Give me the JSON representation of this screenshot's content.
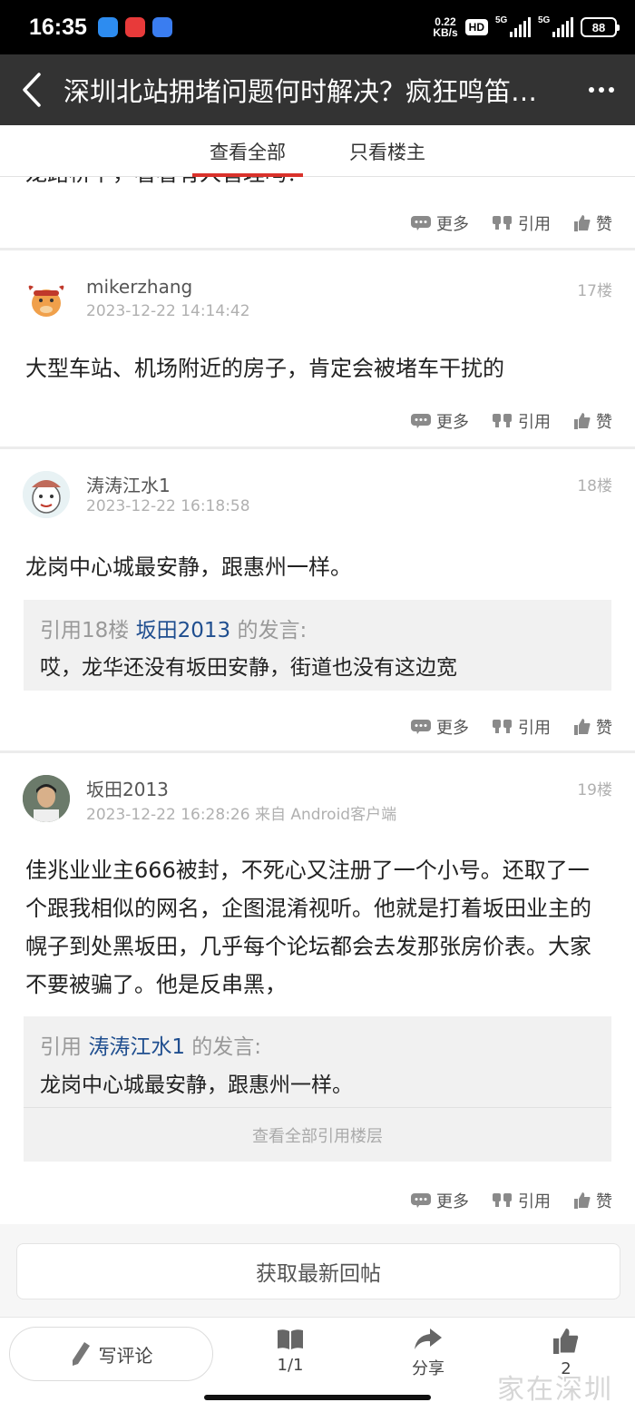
{
  "status_bar": {
    "time": "16:35",
    "net_speed_value": "0.22",
    "net_speed_unit": "KB/s",
    "hd_badge": "HD",
    "signal1": "5G",
    "signal2": "5G",
    "battery": "88"
  },
  "header": {
    "title": "深圳北站拥堵问题何时解决？疯狂鸣笛…"
  },
  "tabs": {
    "all": "查看全部",
    "op_only": "只看楼主"
  },
  "actions": {
    "more": "更多",
    "quote": "引用",
    "like": "赞"
  },
  "posts": [
    {
      "cut_text": "龙路桥下，看看有人管理吗？"
    },
    {
      "username": "mikerzhang",
      "time": "2023-12-22 14:14:42",
      "floor": "17楼",
      "content": "大型车站、机场附近的房子，肯定会被堵车干扰的"
    },
    {
      "username": "涛涛江水1",
      "time": "2023-12-22 16:18:58",
      "floor": "18楼",
      "content": "龙岗中心城最安静，跟惠州一样。",
      "quote": {
        "prefix": "引用18楼",
        "user": "坂田2013",
        "suffix": "的发言:",
        "text": "哎，龙华还没有坂田安静，街道也没有这边宽"
      }
    },
    {
      "username": "坂田2013",
      "time": "2023-12-22 16:28:26 来自 Android客户端",
      "floor": "19楼",
      "content": "佳兆业业主666被封，不死心又注册了一个小号。还取了一个跟我相似的网名，企图混淆视听。他就是打着坂田业主的幌子到处黑坂田，几乎每个论坛都会去发那张房价表。大家不要被骗了。他是反串黑，",
      "quote": {
        "prefix": "引用",
        "user": "涛涛江水1",
        "suffix": "的发言:",
        "text": "龙岗中心城最安静，跟惠州一样。",
        "view_all": "查看全部引用楼层"
      }
    }
  ],
  "refresh_label": "获取最新回帖",
  "bottom_bar": {
    "comment": "写评论",
    "pages": "1/1",
    "share": "分享",
    "likes": "2"
  },
  "watermark": "家在深圳",
  "colors": {
    "accent": "#d9322b",
    "link": "#1f4e8f",
    "header_bg": "#333333"
  }
}
